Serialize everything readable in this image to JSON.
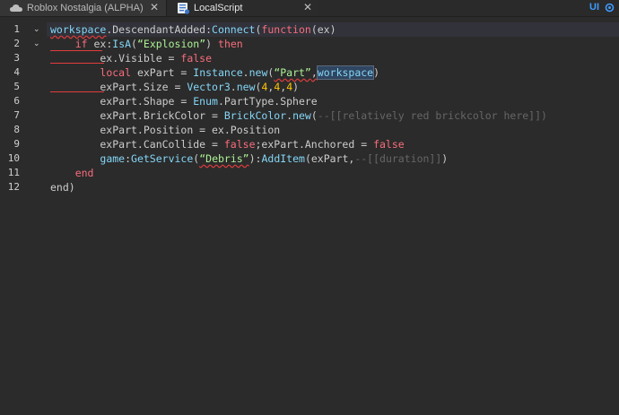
{
  "tabs": [
    {
      "label": "Roblox Nostalgia (ALPHA)",
      "close": "✕",
      "icon": "cloud-icon",
      "active": false
    },
    {
      "label": "LocalScript",
      "close": "✕",
      "icon": "script-icon",
      "active": true
    }
  ],
  "toolbar": {
    "ui_label": "UI",
    "icon": "ui-settings-icon"
  },
  "line_numbers": [
    "1",
    "2",
    "3",
    "4",
    "5",
    "6",
    "7",
    "8",
    "9",
    "10",
    "11",
    "12"
  ],
  "colors": {
    "keyword": "#f86d7c",
    "builtin": "#84d6f7",
    "string": "#adf195",
    "number": "#ffc600",
    "comment": "#666666",
    "text": "#cccccc",
    "error": "#e23c3c",
    "accent": "#3f9bff"
  },
  "code": [
    [
      [
        "workspace",
        "bi"
      ],
      [
        ".DescendantAdded:",
        "id"
      ],
      [
        "Connect",
        "bi"
      ],
      [
        "(",
        "id"
      ],
      [
        "function",
        "kw"
      ],
      [
        "(ex)",
        "id"
      ]
    ],
    [
      [
        "    ",
        "id"
      ],
      [
        "if",
        "kw"
      ],
      [
        " ex:",
        "id"
      ],
      [
        "IsA",
        "bi"
      ],
      [
        "(",
        "id"
      ],
      [
        "“Explosion”",
        "str"
      ],
      [
        ") ",
        "id"
      ],
      [
        "then",
        "kw"
      ]
    ],
    [
      [
        "        ex.Visible = ",
        "id"
      ],
      [
        "false",
        "kw"
      ]
    ],
    [
      [
        "        ",
        "id"
      ],
      [
        "local",
        "kw"
      ],
      [
        " exPart = ",
        "id"
      ],
      [
        "Instance",
        "bi"
      ],
      [
        ".",
        "id"
      ],
      [
        "new",
        "bi"
      ],
      [
        "(",
        "id"
      ],
      [
        "“Part”",
        "str"
      ],
      [
        ",",
        "id"
      ],
      [
        "workspace",
        "bi"
      ],
      [
        ")",
        "id"
      ]
    ],
    [
      [
        "        exPart.Size = ",
        "id"
      ],
      [
        "Vector3",
        "bi"
      ],
      [
        ".",
        "id"
      ],
      [
        "new",
        "bi"
      ],
      [
        "(",
        "id"
      ],
      [
        "4",
        "num"
      ],
      [
        ",",
        "id"
      ],
      [
        "4",
        "num"
      ],
      [
        ",",
        "id"
      ],
      [
        "4",
        "num"
      ],
      [
        ")",
        "id"
      ]
    ],
    [
      [
        "        exPart.Shape = ",
        "id"
      ],
      [
        "Enum",
        "bi"
      ],
      [
        ".PartType.Sphere",
        "id"
      ]
    ],
    [
      [
        "        exPart.BrickColor = ",
        "id"
      ],
      [
        "BrickColor",
        "bi"
      ],
      [
        ".",
        "id"
      ],
      [
        "new",
        "bi"
      ],
      [
        "(",
        "id"
      ],
      [
        "--[[relatively red brickcolor here]])",
        "cm"
      ]
    ],
    [
      [
        "        exPart.Position = ex.Position",
        "id"
      ]
    ],
    [
      [
        "        exPart.CanCollide = ",
        "id"
      ],
      [
        "false",
        "kw"
      ],
      [
        ";exPart.Anchored = ",
        "id"
      ],
      [
        "false",
        "kw"
      ]
    ],
    [
      [
        "        ",
        "id"
      ],
      [
        "game",
        "bi"
      ],
      [
        ":",
        "id"
      ],
      [
        "GetService",
        "bi"
      ],
      [
        "(",
        "id"
      ],
      [
        "“Debris”",
        "str"
      ],
      [
        "):",
        "id"
      ],
      [
        "AddItem",
        "bi"
      ],
      [
        "(exPart,",
        "id"
      ],
      [
        "--[[duration]]",
        "cm"
      ],
      [
        ")",
        "id"
      ]
    ],
    [
      [
        "    ",
        "id"
      ],
      [
        "end",
        "kw"
      ]
    ],
    [
      [
        "end",
        "id"
      ],
      [
        ")",
        "id"
      ]
    ]
  ]
}
